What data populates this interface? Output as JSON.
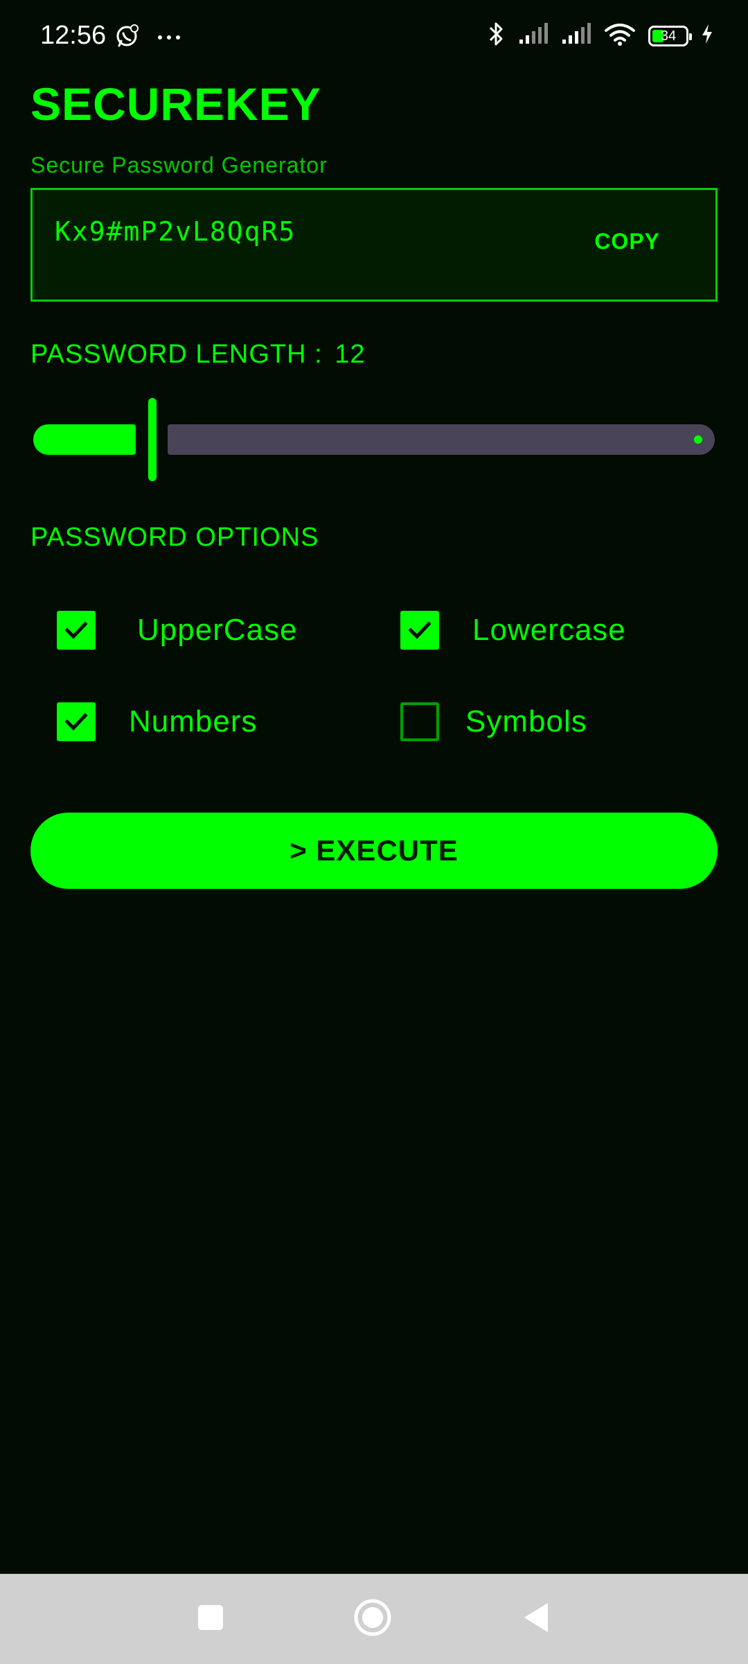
{
  "status_bar": {
    "time": "12:56",
    "battery_level": "34",
    "icons": [
      "chat-notification-icon",
      "more-icon",
      "bluetooth-icon",
      "signal-icon",
      "signal-icon",
      "wifi-icon",
      "battery-icon",
      "charging-icon"
    ]
  },
  "app": {
    "title": "SECUREKEY",
    "subtitle": "Secure Password Generator"
  },
  "password": {
    "value": "Kx9#mP2vL8QqR5",
    "copy_label": "COPY"
  },
  "length": {
    "label": "PASSWORD LENGTH :",
    "value": "12"
  },
  "options": {
    "heading": "PASSWORD OPTIONS",
    "items": [
      {
        "label": "UpperCase",
        "checked": true
      },
      {
        "label": "Lowercase",
        "checked": true
      },
      {
        "label": "Numbers",
        "checked": true
      },
      {
        "label": "Symbols",
        "checked": false
      }
    ]
  },
  "execute": {
    "label": "> EXECUTE"
  },
  "nav": {
    "items": [
      "recents-icon",
      "home-icon",
      "back-icon"
    ]
  },
  "colors": {
    "background": "#020c02",
    "accent": "#00ff00",
    "slider_track": "#4a4458",
    "nav_background": "#d0d0d0"
  }
}
